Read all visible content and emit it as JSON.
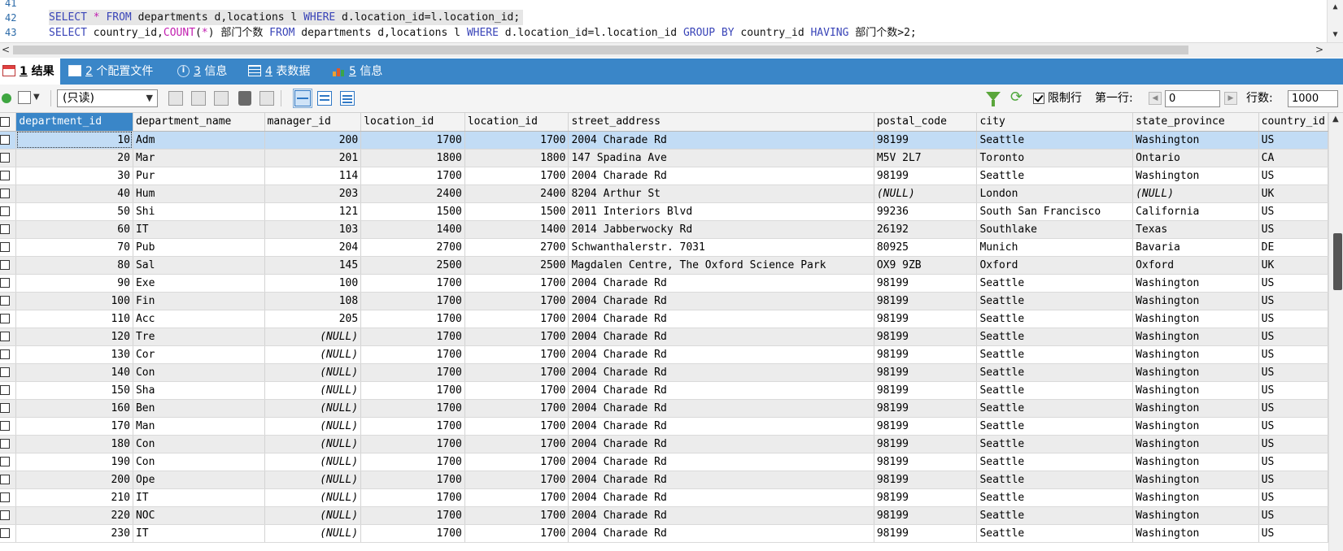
{
  "editor": {
    "lines": [
      {
        "num": "41",
        "html": ""
      },
      {
        "num": "42",
        "tokens": [
          [
            "kw",
            "SELECT"
          ],
          [
            "ch",
            " "
          ],
          [
            "fn",
            "*"
          ],
          [
            "ch",
            " "
          ],
          [
            "kw",
            "FROM"
          ],
          [
            "ch",
            " departments d,locations l "
          ],
          [
            "kw",
            "WHERE"
          ],
          [
            "ch",
            " d.location_id=l.location_id;"
          ]
        ]
      },
      {
        "num": "43",
        "tokens": [
          [
            "kw",
            "SELECT"
          ],
          [
            "ch",
            " country_id,"
          ],
          [
            "fn",
            "COUNT"
          ],
          [
            "ch",
            "("
          ],
          [
            "fn",
            "*"
          ],
          [
            "ch",
            ") 部门个数 "
          ],
          [
            "kw",
            "FROM"
          ],
          [
            "ch",
            " departments d,locations l "
          ],
          [
            "kw",
            "WHERE"
          ],
          [
            "ch",
            " d.location_id=l.location_id "
          ],
          [
            "kw",
            "GROUP BY"
          ],
          [
            "ch",
            " country_id "
          ],
          [
            "kw",
            "HAVING"
          ],
          [
            "ch",
            " 部门个数>2;"
          ]
        ]
      }
    ]
  },
  "tabs": [
    {
      "num": "1",
      "label": "结果",
      "icon": "result-grid-icon"
    },
    {
      "num": "2",
      "label": "个配置文件",
      "icon": "profile-icon"
    },
    {
      "num": "3",
      "label": "信息",
      "icon": "info-icon"
    },
    {
      "num": "4",
      "label": "表数据",
      "icon": "table-data-icon"
    },
    {
      "num": "5",
      "label": "信息",
      "icon": "chart-info-icon"
    }
  ],
  "toolbar": {
    "mode_value": "(只读)",
    "limit_label": "限制行",
    "first_row_label": "第一行:",
    "first_row_value": "0",
    "rows_label": "行数:",
    "rows_value": "1000"
  },
  "columns": [
    "department_id",
    "department_name",
    "manager_id",
    "location_id",
    "location_id",
    "street_address",
    "postal_code",
    "city",
    "state_province",
    "country_id"
  ],
  "rows": [
    [
      "10",
      "Adm",
      "200",
      "1700",
      "1700",
      "2004 Charade Rd",
      "98199",
      "Seattle",
      "Washington",
      "US"
    ],
    [
      "20",
      "Mar",
      "201",
      "1800",
      "1800",
      "147 Spadina Ave",
      "M5V 2L7",
      "Toronto",
      "Ontario",
      "CA"
    ],
    [
      "30",
      "Pur",
      "114",
      "1700",
      "1700",
      "2004 Charade Rd",
      "98199",
      "Seattle",
      "Washington",
      "US"
    ],
    [
      "40",
      "Hum",
      "203",
      "2400",
      "2400",
      "8204 Arthur St",
      "(NULL)",
      "London",
      "(NULL)",
      "UK"
    ],
    [
      "50",
      "Shi",
      "121",
      "1500",
      "1500",
      "2011 Interiors Blvd",
      "99236",
      "South San Francisco",
      "California",
      "US"
    ],
    [
      "60",
      "IT",
      "103",
      "1400",
      "1400",
      "2014 Jabberwocky Rd",
      "26192",
      "Southlake",
      "Texas",
      "US"
    ],
    [
      "70",
      "Pub",
      "204",
      "2700",
      "2700",
      "Schwanthalerstr. 7031",
      "80925",
      "Munich",
      "Bavaria",
      "DE"
    ],
    [
      "80",
      "Sal",
      "145",
      "2500",
      "2500",
      "Magdalen Centre, The Oxford Science Park",
      "OX9 9ZB",
      "Oxford",
      "Oxford",
      "UK"
    ],
    [
      "90",
      "Exe",
      "100",
      "1700",
      "1700",
      "2004 Charade Rd",
      "98199",
      "Seattle",
      "Washington",
      "US"
    ],
    [
      "100",
      "Fin",
      "108",
      "1700",
      "1700",
      "2004 Charade Rd",
      "98199",
      "Seattle",
      "Washington",
      "US"
    ],
    [
      "110",
      "Acc",
      "205",
      "1700",
      "1700",
      "2004 Charade Rd",
      "98199",
      "Seattle",
      "Washington",
      "US"
    ],
    [
      "120",
      "Tre",
      "(NULL)",
      "1700",
      "1700",
      "2004 Charade Rd",
      "98199",
      "Seattle",
      "Washington",
      "US"
    ],
    [
      "130",
      "Cor",
      "(NULL)",
      "1700",
      "1700",
      "2004 Charade Rd",
      "98199",
      "Seattle",
      "Washington",
      "US"
    ],
    [
      "140",
      "Con",
      "(NULL)",
      "1700",
      "1700",
      "2004 Charade Rd",
      "98199",
      "Seattle",
      "Washington",
      "US"
    ],
    [
      "150",
      "Sha",
      "(NULL)",
      "1700",
      "1700",
      "2004 Charade Rd",
      "98199",
      "Seattle",
      "Washington",
      "US"
    ],
    [
      "160",
      "Ben",
      "(NULL)",
      "1700",
      "1700",
      "2004 Charade Rd",
      "98199",
      "Seattle",
      "Washington",
      "US"
    ],
    [
      "170",
      "Man",
      "(NULL)",
      "1700",
      "1700",
      "2004 Charade Rd",
      "98199",
      "Seattle",
      "Washington",
      "US"
    ],
    [
      "180",
      "Con",
      "(NULL)",
      "1700",
      "1700",
      "2004 Charade Rd",
      "98199",
      "Seattle",
      "Washington",
      "US"
    ],
    [
      "190",
      "Con",
      "(NULL)",
      "1700",
      "1700",
      "2004 Charade Rd",
      "98199",
      "Seattle",
      "Washington",
      "US"
    ],
    [
      "200",
      "Ope",
      "(NULL)",
      "1700",
      "1700",
      "2004 Charade Rd",
      "98199",
      "Seattle",
      "Washington",
      "US"
    ],
    [
      "210",
      "IT",
      "(NULL)",
      "1700",
      "1700",
      "2004 Charade Rd",
      "98199",
      "Seattle",
      "Washington",
      "US"
    ],
    [
      "220",
      "NOC",
      "(NULL)",
      "1700",
      "1700",
      "2004 Charade Rd",
      "98199",
      "Seattle",
      "Washington",
      "US"
    ],
    [
      "230",
      "IT",
      "(NULL)",
      "1700",
      "1700",
      "2004 Charade Rd",
      "98199",
      "Seattle",
      "Washington",
      "US"
    ]
  ],
  "colors": {
    "accent": "#3a86c8",
    "keyword": "#3a45b8",
    "function": "#c21fb0",
    "selected_row": "#c2dcf5"
  }
}
